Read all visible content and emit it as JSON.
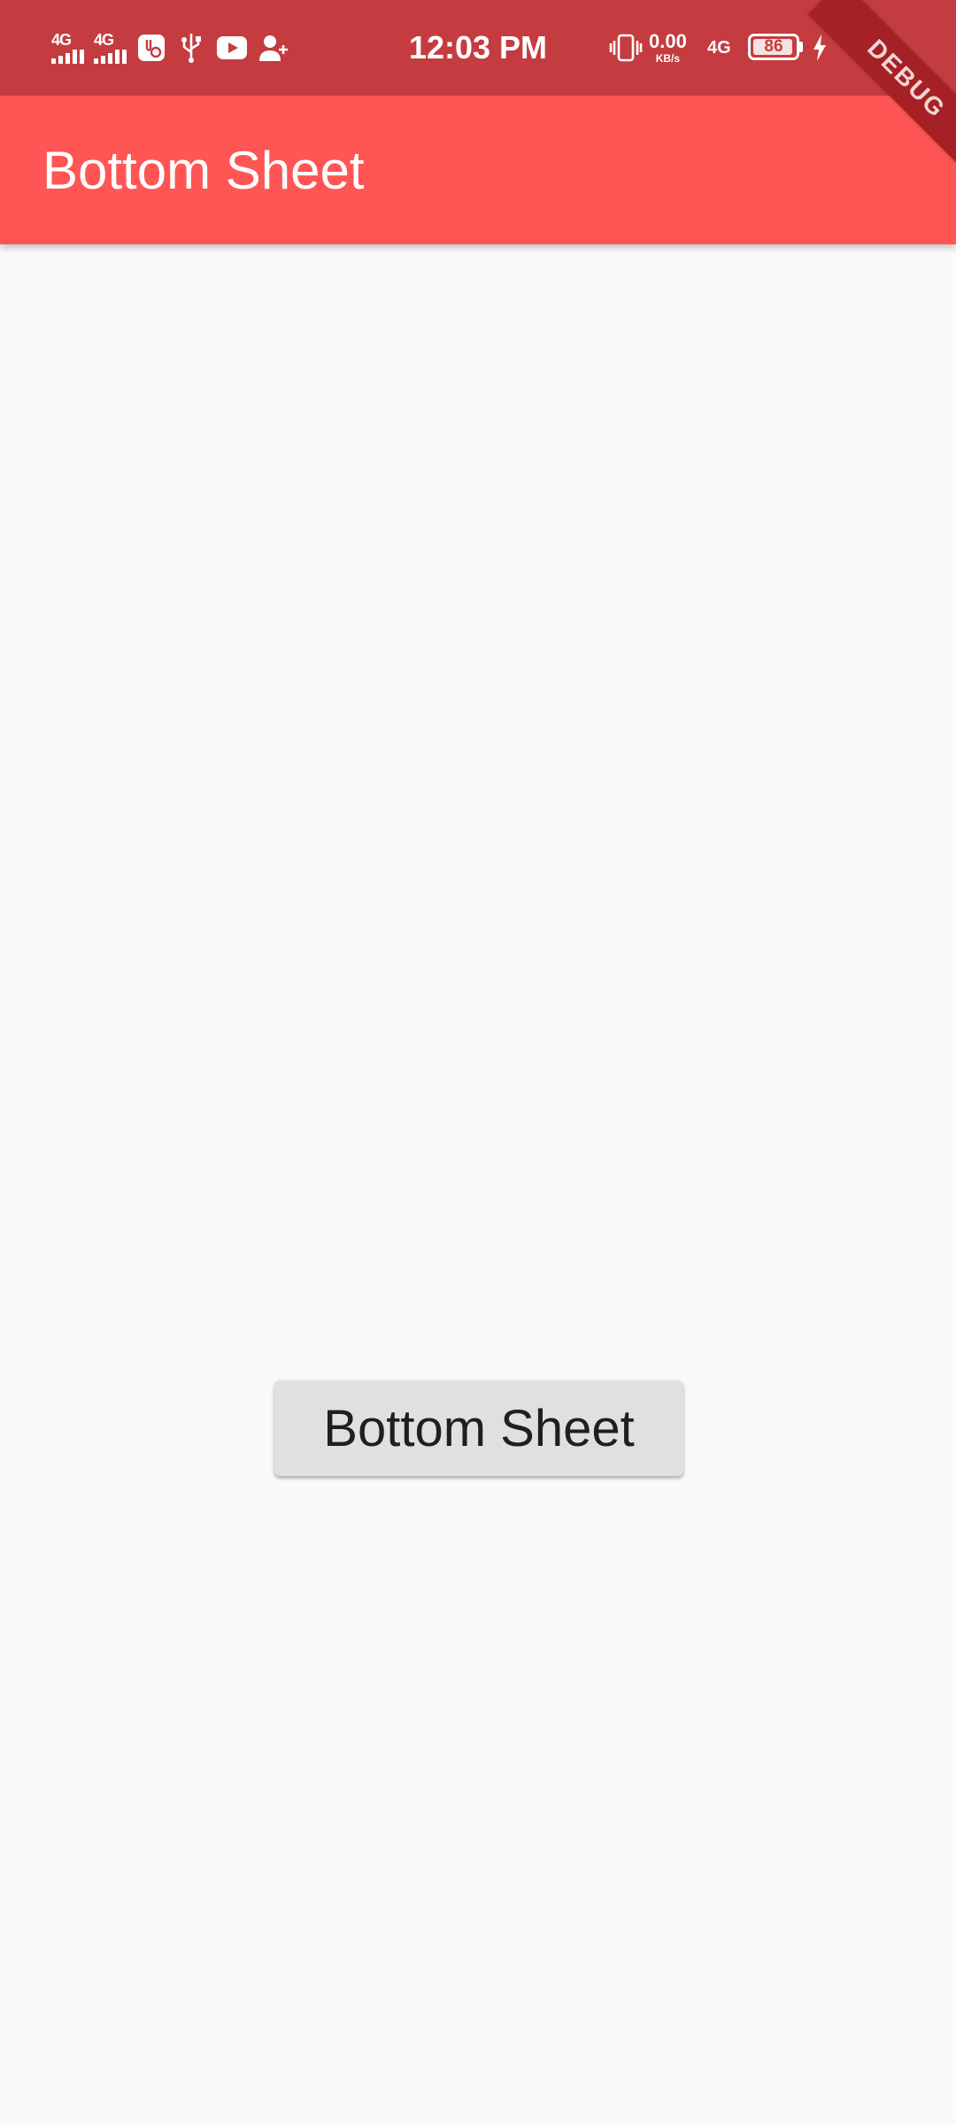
{
  "status_bar": {
    "sim1_network": "4G",
    "sim2_network": "4G",
    "time": "12:03 PM",
    "speed_value": "0.00",
    "speed_unit": "KB/s",
    "data_network": "4G",
    "battery_level": "86",
    "background_color": "#C43C3F",
    "icons": [
      "signal-icon",
      "signal-icon",
      "usb-debug-icon",
      "usb-icon",
      "youtube-icon",
      "add-person-icon",
      "vibrate-icon",
      "battery-icon",
      "charging-icon"
    ]
  },
  "app_bar": {
    "title": "Bottom Sheet",
    "background_color": "#FF5555"
  },
  "main": {
    "button_label": "Bottom Sheet",
    "button_color": "#E0E0E0"
  },
  "debug_banner": {
    "label": "DEBUG"
  }
}
